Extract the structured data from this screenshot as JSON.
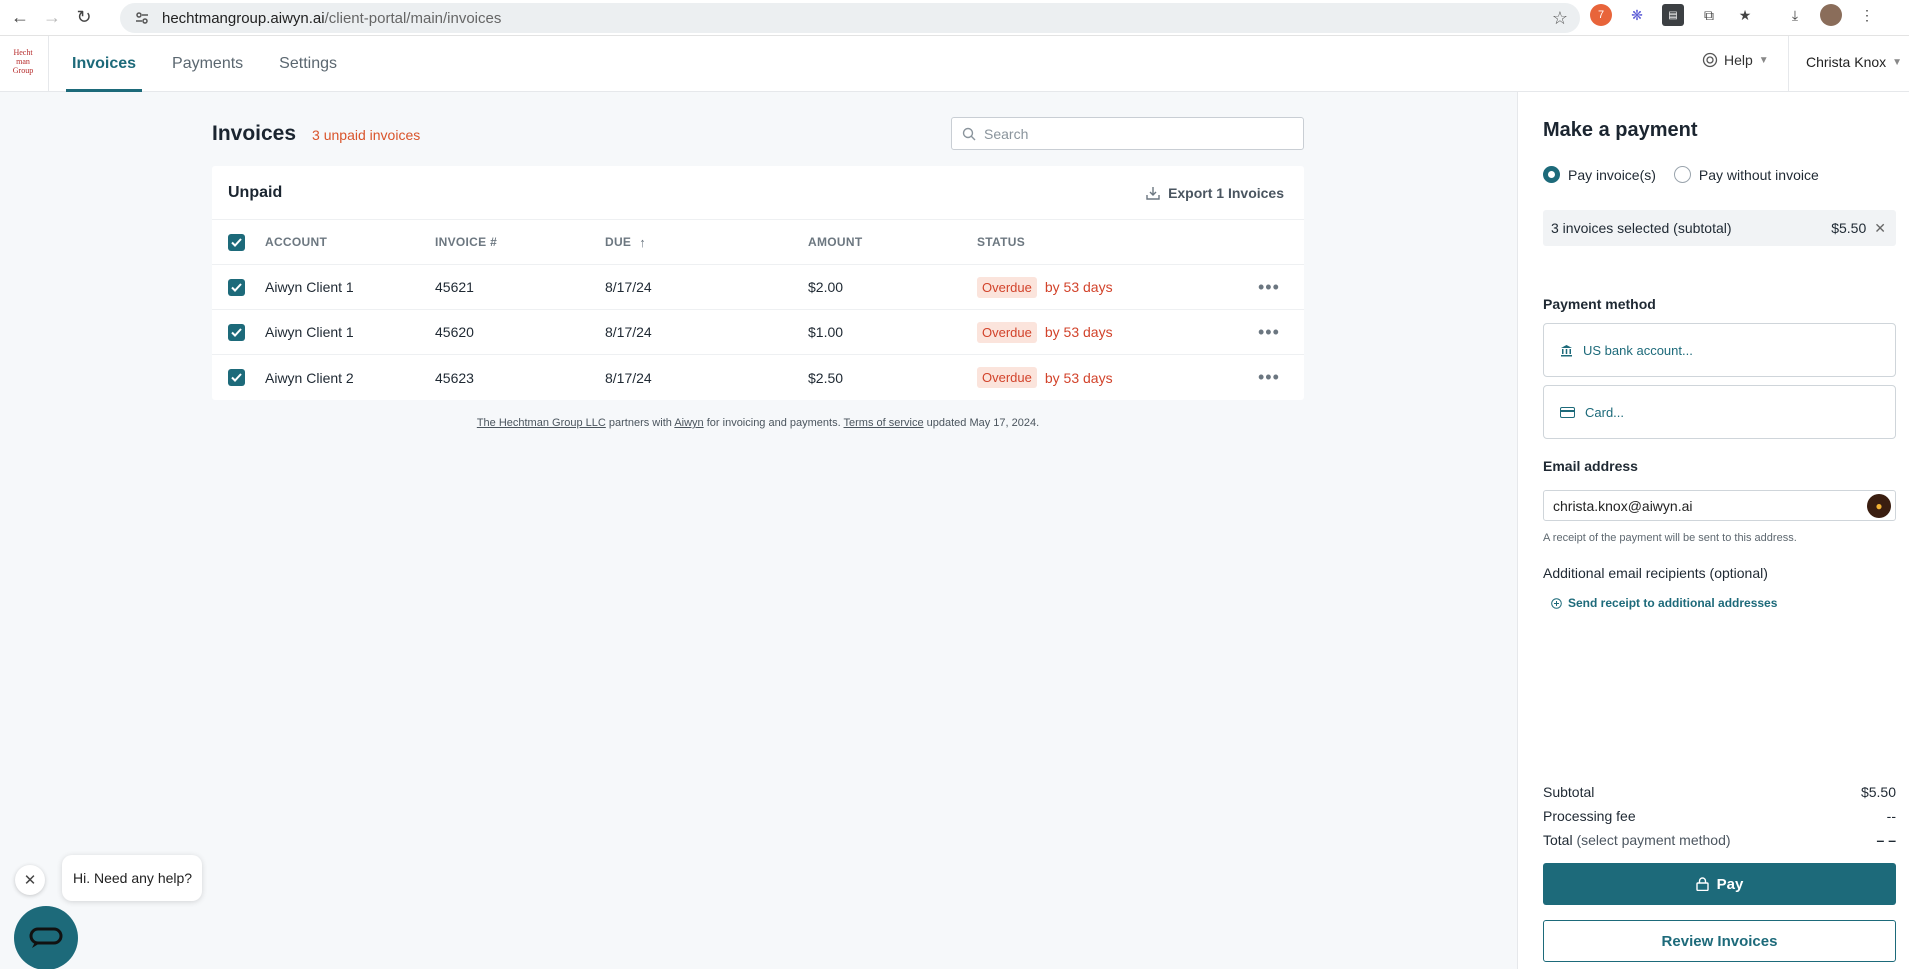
{
  "browser": {
    "url_host": "hechtmangroup.aiwyn.ai",
    "url_path": "/client-portal/main/invoices"
  },
  "header": {
    "logo_text": "Hechtman Group",
    "tabs": [
      {
        "label": "Invoices",
        "active": true
      },
      {
        "label": "Payments",
        "active": false
      },
      {
        "label": "Settings",
        "active": false
      }
    ],
    "help_label": "Help",
    "user_name": "Christa Knox"
  },
  "invoices": {
    "title": "Invoices",
    "unpaid_count": "3 unpaid invoices",
    "search_placeholder": "Search",
    "section_title": "Unpaid",
    "export_label": "Export 1 Invoices",
    "columns": {
      "account": "ACCOUNT",
      "invoice": "INVOICE #",
      "due": "DUE",
      "amount": "AMOUNT",
      "status": "STATUS"
    },
    "rows": [
      {
        "account": "Aiwyn Client 1",
        "invoice": "45621",
        "due": "8/17/24",
        "amount": "$2.00",
        "status": "Overdue",
        "overdue": "by 53 days"
      },
      {
        "account": "Aiwyn Client 1",
        "invoice": "45620",
        "due": "8/17/24",
        "amount": "$1.00",
        "status": "Overdue",
        "overdue": "by 53 days"
      },
      {
        "account": "Aiwyn Client 2",
        "invoice": "45623",
        "due": "8/17/24",
        "amount": "$2.50",
        "status": "Overdue",
        "overdue": "by 53 days"
      }
    ],
    "footer": {
      "firm": "The Hechtman Group LLC",
      "partners": "partners with",
      "aiwyn": "Aiwyn",
      "purpose": "for invoicing and payments.",
      "terms": "Terms of service",
      "updated": "updated May 17, 2024."
    }
  },
  "payment": {
    "title": "Make a payment",
    "radio_pay_invoices": "Pay invoice(s)",
    "radio_pay_without": "Pay without invoice",
    "selected_text": "3 invoices selected (subtotal)",
    "selected_amount": "$5.50",
    "method_label": "Payment method",
    "method_bank": "US bank account...",
    "method_card": "Card...",
    "email_label": "Email address",
    "email_value": "christa.knox@aiwyn.ai",
    "email_hint": "A receipt of the payment will be sent to this address.",
    "additional_label": "Additional email recipients (optional)",
    "additional_link": "Send receipt to additional addresses",
    "subtotal_label": "Subtotal",
    "subtotal_value": "$5.50",
    "fee_label": "Processing fee",
    "fee_value": "--",
    "total_label": "Total",
    "total_note": "(select payment method)",
    "total_value": "– –",
    "pay_button": "Pay",
    "review_button": "Review Invoices"
  },
  "chat": {
    "greeting": "Hi. Need any help?"
  },
  "colors": {
    "accent": "#1d6a7a",
    "overdue": "#d2432b"
  }
}
